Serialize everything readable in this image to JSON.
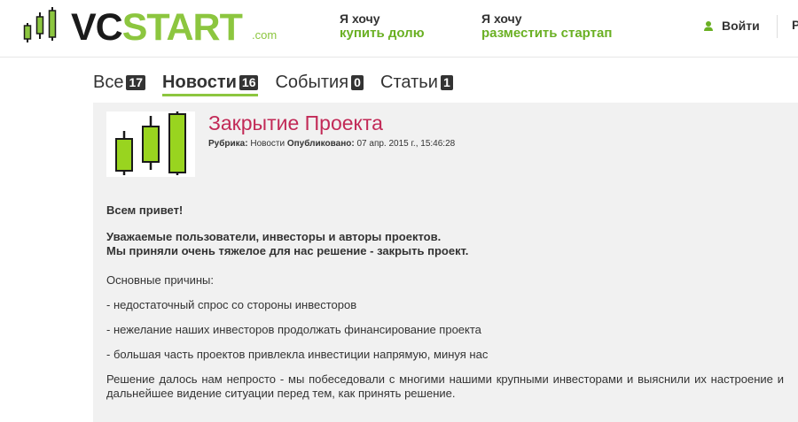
{
  "header": {
    "logo": {
      "vc": "VC",
      "start": "START",
      "dotcom": ".com"
    },
    "nav": [
      {
        "pre": "Я хочу",
        "main": "купить долю"
      },
      {
        "pre": "Я хочу",
        "main": "разместить стартап"
      }
    ],
    "login_label": "Войти",
    "cut_letter": "Р"
  },
  "tabs": [
    {
      "label": "Все",
      "count": "17"
    },
    {
      "label": "Новости",
      "count": "16",
      "active": true
    },
    {
      "label": "События",
      "count": "0"
    },
    {
      "label": "Статьи",
      "count": "1"
    }
  ],
  "article": {
    "title": "Закрытие Проекта",
    "meta": {
      "rubric_label": "Рубрика:",
      "rubric_value": "Новости",
      "published_label": "Опубликовано:",
      "published_value": "07 апр. 2015 г., 15:46:28"
    },
    "greeting": "Всем привет!",
    "bold_line1": "Уважаемые пользователи, инвесторы и авторы проектов.",
    "bold_line2": "Мы приняли очень тяжелое для нас решение - закрыть проект.",
    "reasons_heading": "Основные причины:",
    "reasons": [
      "- недостаточный спрос со стороны инвесторов",
      "- нежелание наших инвесторов продолжать финансирование проекта",
      "- большая часть проектов привлекла инвестиции напрямую, минуя нас"
    ],
    "closing": "Решение далось нам непросто - мы побеседовали с многими нашими крупными инвесторами и выяснили их настроение и дальнейшее видение ситуации перед тем, как принять решение."
  },
  "colors": {
    "brand_green": "#8cc63f",
    "link_green": "#6ab023",
    "title_crimson": "#c22a57",
    "dark": "#333333",
    "article_bg": "#f1f1f1"
  },
  "icons": [
    "candlestick-logo-icon",
    "user-icon",
    "candlestick-thumbnail-icon"
  ]
}
